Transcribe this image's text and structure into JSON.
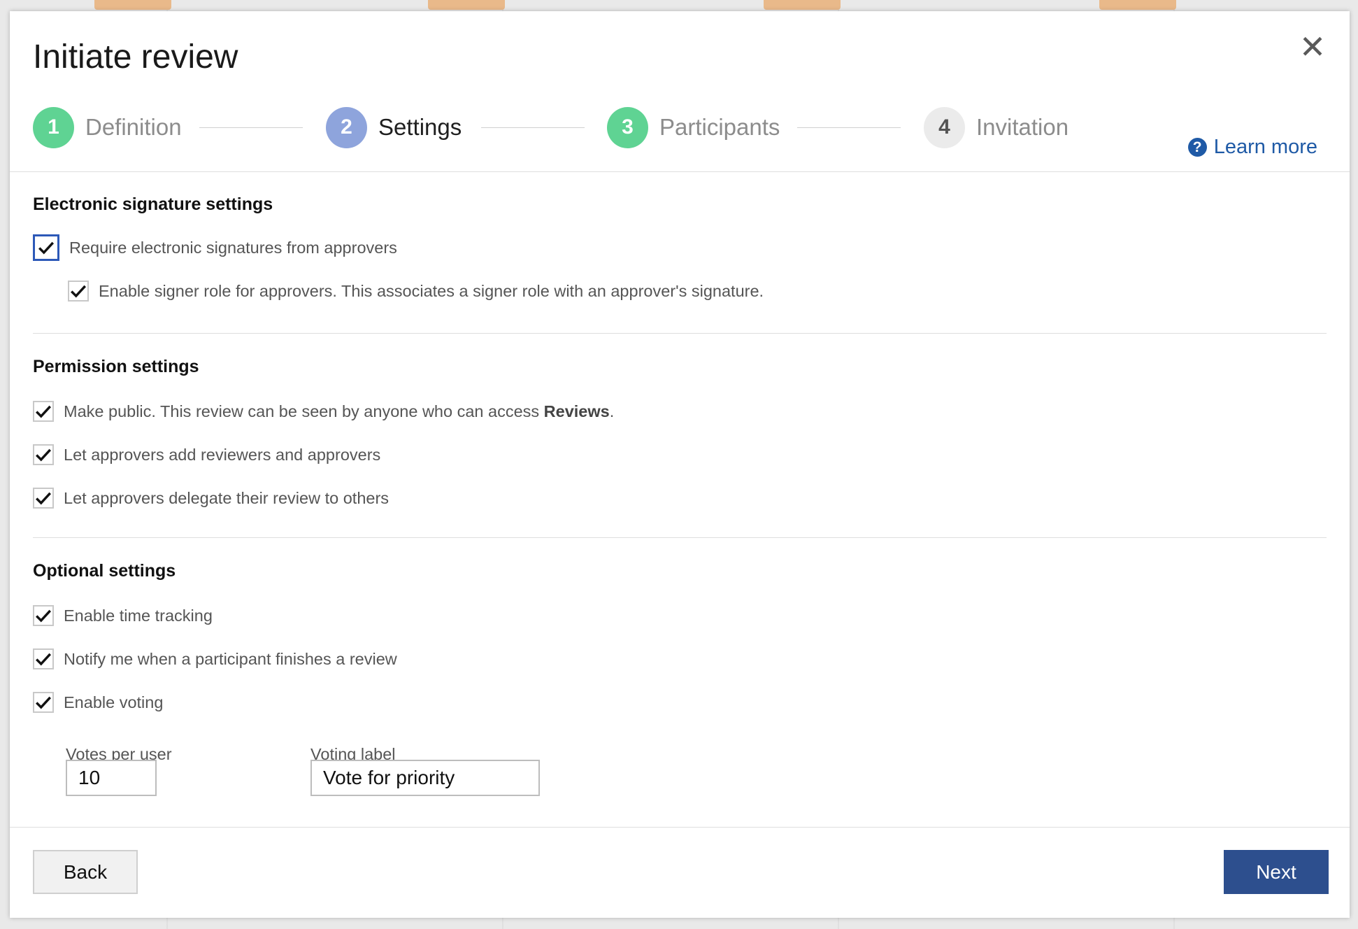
{
  "dialog": {
    "title": "Initiate review",
    "close_glyph": "✕",
    "learn_more": "Learn more",
    "help_glyph": "?"
  },
  "steps": [
    {
      "number": "1",
      "label": "Definition",
      "color": "#5fd393",
      "state": "done"
    },
    {
      "number": "2",
      "label": "Settings",
      "color": "#8ea4dc",
      "state": "active"
    },
    {
      "number": "3",
      "label": "Participants",
      "color": "#5fd393",
      "state": "done"
    },
    {
      "number": "4",
      "label": "Invitation",
      "color": "#ebebeb",
      "state": "pending"
    }
  ],
  "sections": {
    "esig": {
      "title": "Electronic signature settings",
      "require": {
        "label": "Require electronic signatures from approvers",
        "checked": true
      },
      "signer_role": {
        "label": "Enable signer role for approvers. This associates a signer role with an approver's signature.",
        "checked": true
      }
    },
    "permission": {
      "title": "Permission settings",
      "make_public": {
        "label_prefix": "Make public. This review can be seen by anyone who can access ",
        "label_bold": "Reviews",
        "label_suffix": ".",
        "checked": true
      },
      "add_reviewers": {
        "label": "Let approvers add reviewers and approvers",
        "checked": true
      },
      "delegate": {
        "label": "Let approvers delegate their review to others",
        "checked": true
      }
    },
    "optional": {
      "title": "Optional settings",
      "time_tracking": {
        "label": "Enable time tracking",
        "checked": true
      },
      "notify": {
        "label": "Notify me when a participant finishes a review",
        "checked": true
      },
      "voting": {
        "label": "Enable voting",
        "checked": true
      },
      "votes_per_user": {
        "label": "Votes per user",
        "value": "10"
      },
      "voting_label": {
        "label": "Voting label",
        "value": "Vote for priority"
      }
    }
  },
  "footer": {
    "back_label": "Back",
    "next_label": "Next"
  },
  "colors": {
    "accent": "#2d4f8e",
    "link": "#1f5aa6",
    "focus_border": "#2d59b8"
  }
}
